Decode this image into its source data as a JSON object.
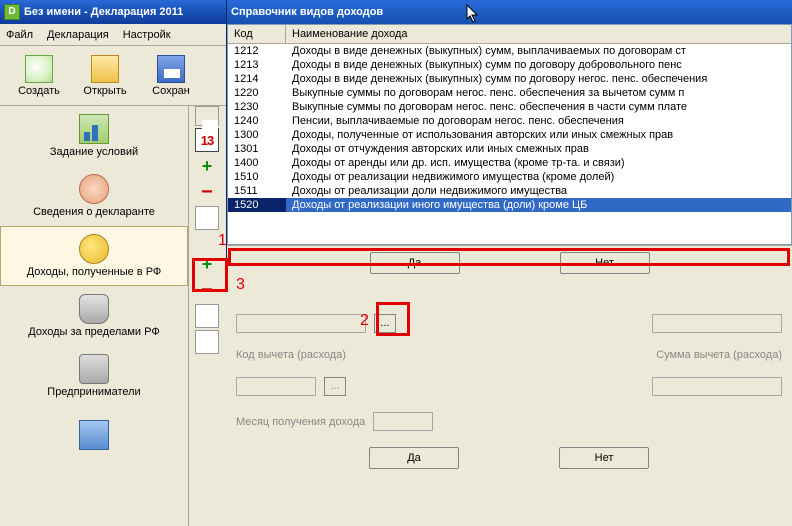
{
  "main_window": {
    "title": "Без имени - Декларация 2011",
    "menu": {
      "file": "Файл",
      "decl": "Декларация",
      "settings": "Настройк"
    },
    "toolbar": {
      "create": "Создать",
      "open": "Открыть",
      "save": "Сохран"
    }
  },
  "sidebar": {
    "items": [
      {
        "label": "Задание условий"
      },
      {
        "label": "Сведения о декларанте"
      },
      {
        "label": "Доходы, полученные в РФ"
      },
      {
        "label": "Доходы за пределами РФ"
      },
      {
        "label": "Предприниматели"
      },
      {
        "label": ""
      }
    ]
  },
  "mini": {
    "thirteen": "13"
  },
  "popup": {
    "title": "Справочник видов доходов",
    "col_code": "Код",
    "col_name": "Наименование дохода",
    "rows": [
      {
        "code": "1212",
        "name": "Доходы в виде денежных (выкупных) сумм, выплачиваемых по договорам ст"
      },
      {
        "code": "1213",
        "name": "Доходы в виде денежных (выкупных) сумм по договору добровольного пенс"
      },
      {
        "code": "1214",
        "name": "Доходы в виде денежных (выкупных) сумм по договору негос. пенс. обеспечения"
      },
      {
        "code": "1220",
        "name": "Выкупные суммы по договорам негос. пенс. обеспечения за вычетом сумм п"
      },
      {
        "code": "1230",
        "name": "Выкупные суммы по договорам негос. пенс. обеспечения в части сумм плате"
      },
      {
        "code": "1240",
        "name": "Пенсии, выплачиваемые по договорам негос. пенс. обеспечения"
      },
      {
        "code": "1300",
        "name": "Доходы, полученные от использования авторских или иных смежных прав"
      },
      {
        "code": "1301",
        "name": "Доходы от отчуждения авторских или иных смежных прав"
      },
      {
        "code": "1400",
        "name": "Доходы от аренды или др. исп. имущества (кроме тр-та. и связи)"
      },
      {
        "code": "1510",
        "name": "Доходы от реализации недвижимого имущества (кроме долей)"
      },
      {
        "code": "1511",
        "name": "Доходы от реализации доли недвижимого имущества"
      },
      {
        "code": "1520",
        "name": "Доходы от реализации иного имущества (доли) кроме ЦБ"
      }
    ],
    "selected_code": "1520",
    "yes": "Да",
    "no": "Нет"
  },
  "inner_form": {
    "deduction_code_label": "Код вычета (расхода)",
    "deduction_sum_label": "Сумма вычета (расхода)",
    "month_label": "Месяц получения дохода",
    "dots": "...",
    "yes": "Да",
    "no": "Нет"
  },
  "annotations": {
    "l1": "1",
    "l2": "2",
    "l3": "3"
  }
}
